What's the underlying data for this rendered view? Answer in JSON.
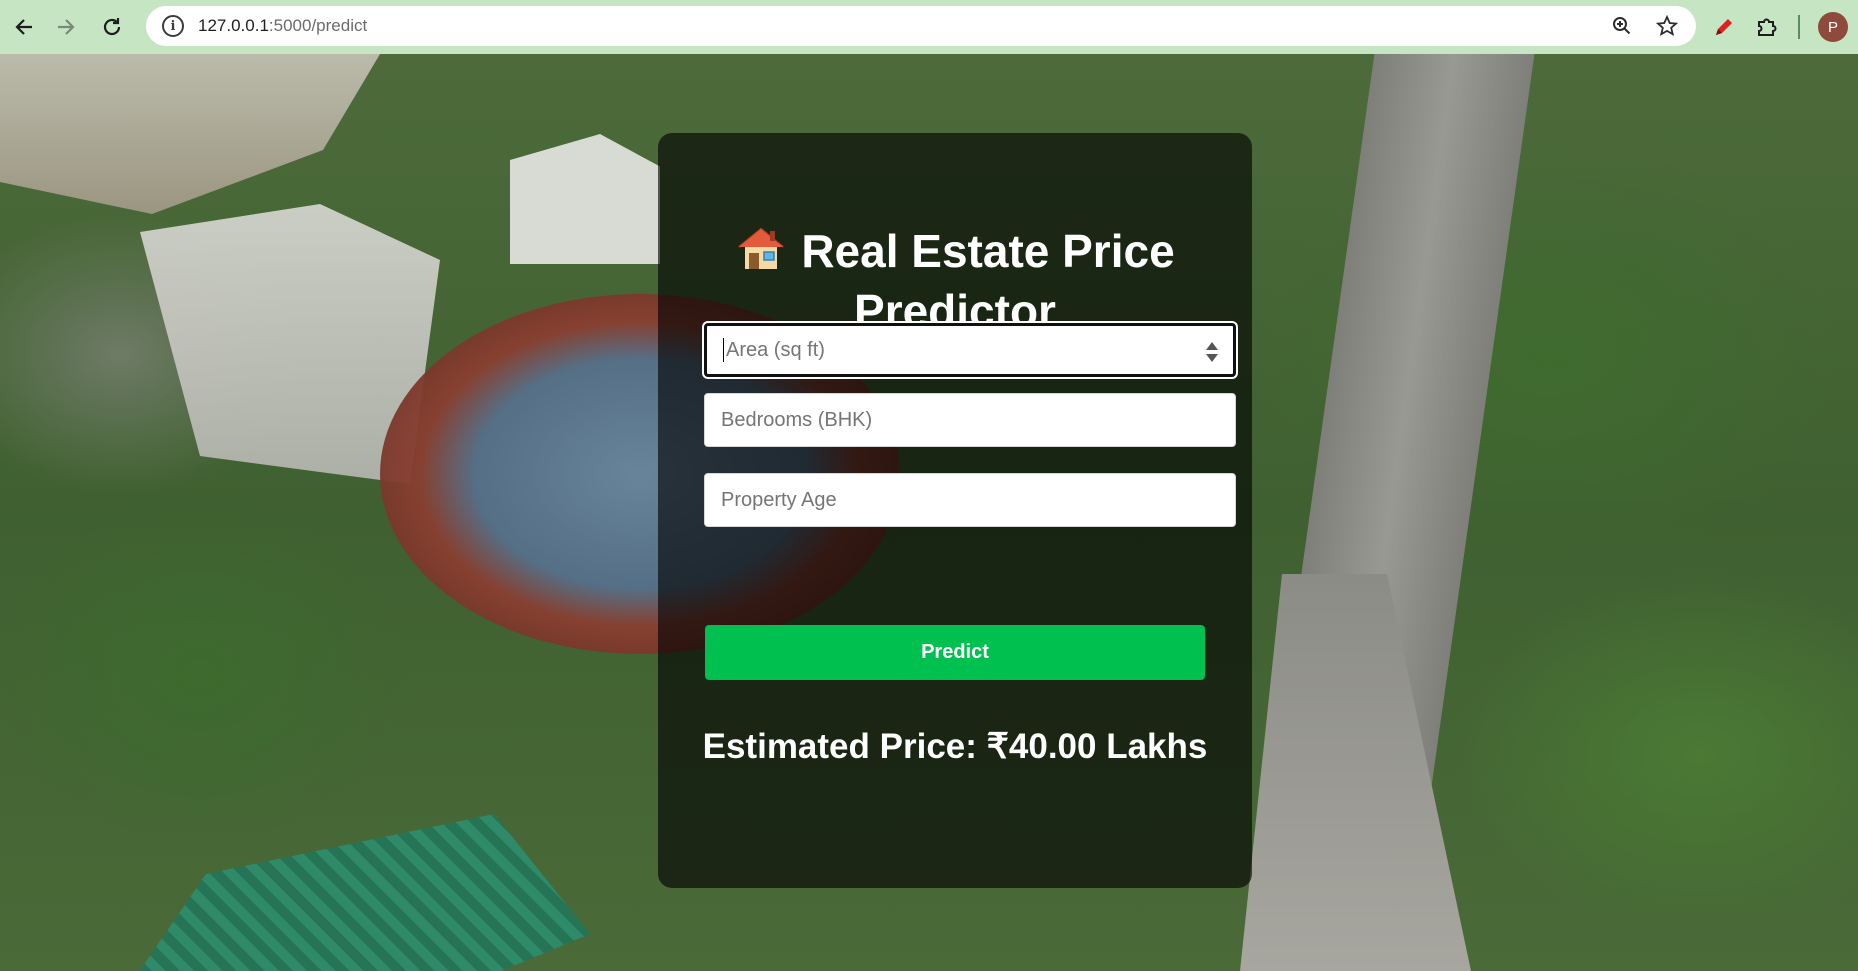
{
  "browser": {
    "url_host": "127.0.0.1",
    "url_path": ":5000/predict",
    "avatar_letter": "P",
    "icons": [
      "back-arrow-icon",
      "forward-arrow-icon",
      "reload-icon",
      "site-info-icon",
      "zoom-icon",
      "bookmark-star-icon",
      "pen-extension-icon",
      "puzzle-extensions-icon"
    ]
  },
  "app": {
    "title": "Real Estate Price Predictor",
    "title_icon": "house-emoji-icon",
    "fields": [
      {
        "id": "area",
        "placeholder": "Area (sq ft)",
        "value": ""
      },
      {
        "id": "bedrooms",
        "placeholder": "Bedrooms (BHK)",
        "value": ""
      },
      {
        "id": "age",
        "placeholder": "Property Age",
        "value": ""
      }
    ],
    "predict_label": "Predict",
    "result_text": "Estimated Price: ₹40.00 Lakhs"
  },
  "colors": {
    "browser_bar": "#c6e6c3",
    "predict_button": "#00c04f",
    "card_overlay": "rgba(0,0,0,0.62)"
  }
}
